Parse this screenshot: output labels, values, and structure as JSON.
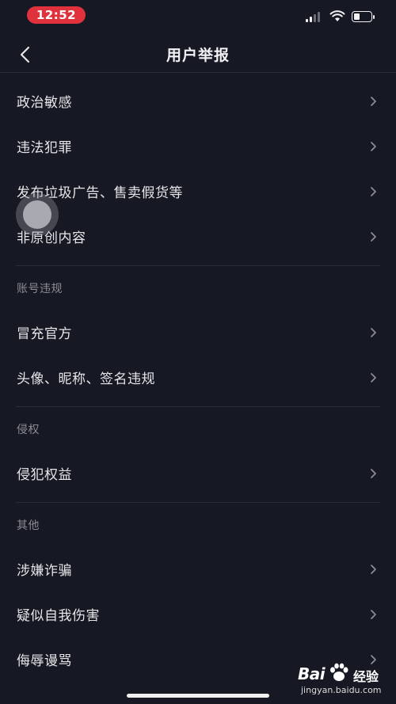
{
  "status_bar": {
    "time": "12:52"
  },
  "header": {
    "title": "用户举报"
  },
  "groups": [
    {
      "title": "",
      "items": [
        "政治敏感",
        "违法犯罪",
        "发布垃圾广告、售卖假货等",
        "非原创内容"
      ]
    },
    {
      "title": "账号违规",
      "items": [
        "冒充官方",
        "头像、昵称、签名违规"
      ]
    },
    {
      "title": "侵权",
      "items": [
        "侵犯权益"
      ]
    },
    {
      "title": "其他",
      "items": [
        "涉嫌诈骗",
        "疑似自我伤害",
        "侮辱谩骂"
      ]
    }
  ],
  "watermark": {
    "brand": "Bai",
    "name": "经验",
    "url": "jingyan.baidu.com"
  },
  "colors": {
    "background": "#161823",
    "status_pill": "#e0323c",
    "section_text": "#8a8b93",
    "divider": "#2a2c37"
  },
  "icons": [
    "back-arrow-icon",
    "chevron-right-icon",
    "signal-icon",
    "wifi-icon",
    "battery-icon",
    "baidu-paw-icon"
  ]
}
